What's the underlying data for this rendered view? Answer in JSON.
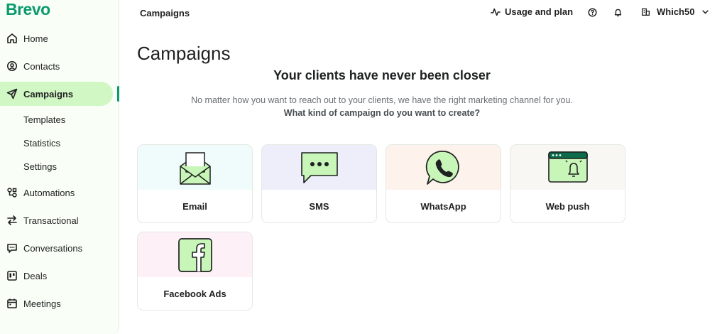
{
  "app": {
    "logo": "Brevo"
  },
  "sidebar": {
    "items": [
      {
        "label": "Home",
        "icon": "home-icon"
      },
      {
        "label": "Contacts",
        "icon": "contacts-icon"
      },
      {
        "label": "Campaigns",
        "icon": "paper-plane-icon",
        "active": true
      },
      {
        "label": "Automations",
        "icon": "automation-icon"
      },
      {
        "label": "Transactional",
        "icon": "transfer-arrows-icon"
      },
      {
        "label": "Conversations",
        "icon": "chat-icon"
      },
      {
        "label": "Deals",
        "icon": "kanban-icon"
      },
      {
        "label": "Meetings",
        "icon": "calendar-icon"
      }
    ],
    "subitems": [
      {
        "label": "Templates"
      },
      {
        "label": "Statistics"
      },
      {
        "label": "Settings"
      }
    ]
  },
  "topbar": {
    "title": "Campaigns",
    "usage_label": "Usage and plan",
    "account_label": "Which50"
  },
  "main": {
    "page_title": "Campaigns",
    "hero_title": "Your clients have never been closer",
    "hero_subtitle": "No matter how you want to reach out to your clients, we have the right marketing channel for you.",
    "hero_question": "What kind of campaign do you want to create?",
    "cards": [
      {
        "label": "Email",
        "bg": "#f0fbfb",
        "icon": "envelope-icon"
      },
      {
        "label": "SMS",
        "bg": "#eeeefb",
        "icon": "sms-bubble-icon"
      },
      {
        "label": "WhatsApp",
        "bg": "#fdf2ec",
        "icon": "whatsapp-icon"
      },
      {
        "label": "Web push",
        "bg": "#f8f7f3",
        "icon": "browser-bell-icon"
      },
      {
        "label": "Facebook Ads",
        "bg": "#fdf1f7",
        "icon": "facebook-icon"
      }
    ]
  },
  "colors": {
    "brand": "#0b996e",
    "active_bg": "#d1f7c4",
    "icon_fill": "#c8f5b8"
  }
}
